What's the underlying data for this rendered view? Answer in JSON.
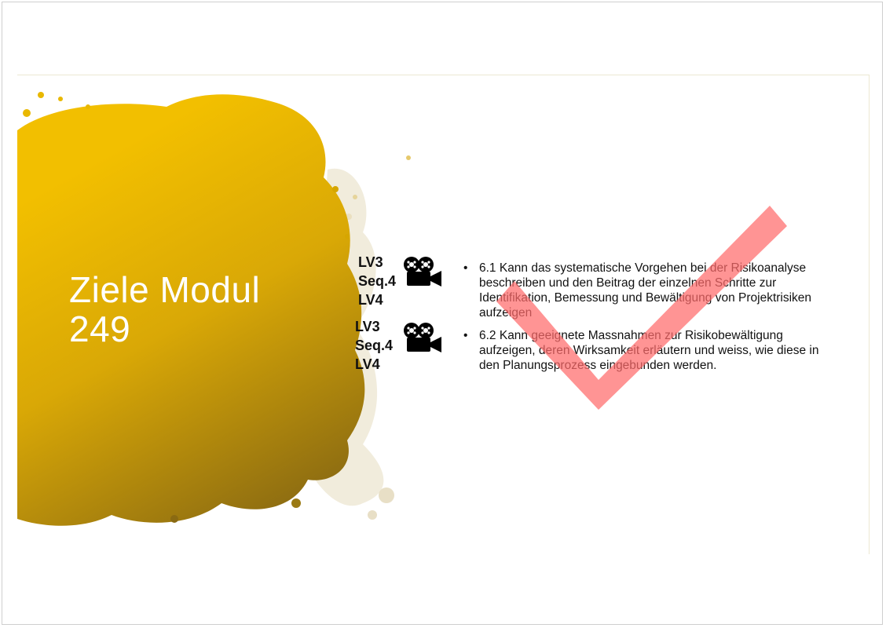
{
  "slide": {
    "title_line1": "Ziele Modul",
    "title_line2": "249",
    "lv_groups": [
      {
        "lines": [
          "LV3",
          "Seq.4",
          "LV4"
        ],
        "icon": "movie-camera-icon"
      },
      {
        "lines": [
          "LV3",
          "Seq.4",
          "LV4"
        ],
        "icon": "movie-camera-icon"
      }
    ],
    "objectives": [
      {
        "bullet": "•",
        "text": "6.1 Kann das systematische Vorgehen bei der Risikoanalyse beschreiben und den Beitrag der einzelnen Schritte zur Identifikation, Bemessung und Bewältigung von Projektrisiken aufzeigen"
      },
      {
        "bullet": "•",
        "text": "6.2 Kann geeignete Massnahmen zur Risikobewältigung aufzeigen, deren Wirksamkeit erläutern und weiss, wie diese in den Planungsprozess eingebunden werden."
      }
    ],
    "colors": {
      "paint_light": "#f2bf00",
      "paint_dark": "#8a6a12",
      "title_text": "#ffffff",
      "checkmark": "#ff6b6b"
    },
    "checkmark_icon": "checkmark-icon"
  }
}
